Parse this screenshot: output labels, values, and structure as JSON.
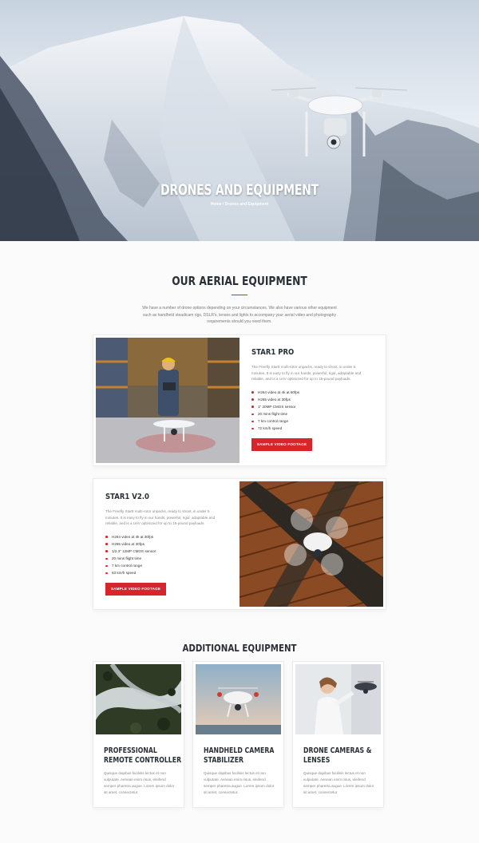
{
  "hero": {
    "title": "DRONES AND EQUIPMENT",
    "breadcrumb": "Home / Drones and Equipment"
  },
  "aerial": {
    "title": "OUR AERIAL EQUIPMENT",
    "intro": "We have a number of drone options depending on your circumstances. We also have various other equipment such as handheld steadicam rigs, DSLR's, lenses and lights to accompany your aerial video and photography requirements should you need them."
  },
  "products": [
    {
      "title": "STAR1 PRO",
      "description": "The Freefly Star8 multi-rotor unpacks, ready to shoot, in under 5 minutes. It is easy to fly in our hands, powerful, rigid, adaptable and reliable, and is a UAV optimized for up to 15-pound payloads.",
      "specs": [
        "H264 video at 4k at 60fps",
        "H265 video at 30fps",
        "1\" 20MP CMOS sensor",
        "20 mins flight time",
        "7 km control range",
        "72 km/h speed"
      ],
      "button": "SAMPLE VIDEO FOOTAGE"
    },
    {
      "title": "STAR1 V2.0",
      "description": "The Freefly Star8 multi-rotor unpacks, ready to shoot, in under 5 minutes. It is easy to fly in our hands, powerful, rigid, adaptable and reliable, and is a UAV optimized for up to 15-pound payloads.",
      "specs": [
        "H264 video at 4k at 30fps",
        "H265 video at 30fps",
        "1/2.3\" 12MP CMOS sensor",
        "20 mins flight time",
        "7 km control range",
        "63 km/h speed"
      ],
      "button": "SAMPLE VIDEO FOOTAGE"
    }
  ],
  "additional": {
    "title": "ADDITIONAL EQUIPMENT",
    "items": [
      {
        "title": "PROFESSIONAL REMOTE CONTROLLER",
        "description": "Quisque dapibus facilisis lectus et non vulputate. Aenean enim risus, eleifend semper pharetra augue. Lorem ipsum dolor sit amet, consectetur."
      },
      {
        "title": "HANDHELD CAMERA STABILIZER",
        "description": "Quisque dapibus facilisis lectus et non vulputate. Aenean enim risus, eleifend semper pharetra augue. Lorem ipsum dolor sit amet, consectetur."
      },
      {
        "title": "DRONE CAMERAS & LENSES",
        "description": "Quisque dapibus facilisis lectus et non vulputate. Aenean enim risus, eleifend semper pharetra augue. Lorem ipsum dolor sit amet, consectetur."
      }
    ]
  },
  "colors": {
    "accent": "#d6262b",
    "heading": "#2b2f36"
  }
}
